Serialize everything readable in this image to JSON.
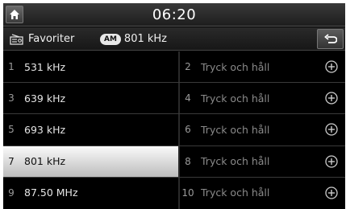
{
  "header": {
    "time": "06:20",
    "home_icon": "home-icon"
  },
  "subheader": {
    "favorites_label": "Favoriter",
    "favorites_icon": "radio-list-icon",
    "band_badge": "AM",
    "current_frequency": "801 kHz",
    "back_icon": "back-arrow-icon"
  },
  "presets": [
    {
      "number": "1",
      "label": "531 kHz",
      "selected": false
    },
    {
      "number": "2",
      "label": "Tryck och håll",
      "empty": true
    },
    {
      "number": "3",
      "label": "639 kHz",
      "selected": false
    },
    {
      "number": "4",
      "label": "Tryck och håll",
      "empty": true
    },
    {
      "number": "5",
      "label": "693 kHz",
      "selected": false
    },
    {
      "number": "6",
      "label": "Tryck och håll",
      "empty": true
    },
    {
      "number": "7",
      "label": "801 kHz",
      "selected": true
    },
    {
      "number": "8",
      "label": "Tryck och håll",
      "empty": true
    },
    {
      "number": "9",
      "label": "87.50 MHz",
      "selected": false
    },
    {
      "number": "10",
      "label": "Tryck och håll",
      "empty": true
    }
  ],
  "colors": {
    "selected_row": "#e0e0e0",
    "background": "#000000",
    "empty_text": "#8a8a8a"
  }
}
